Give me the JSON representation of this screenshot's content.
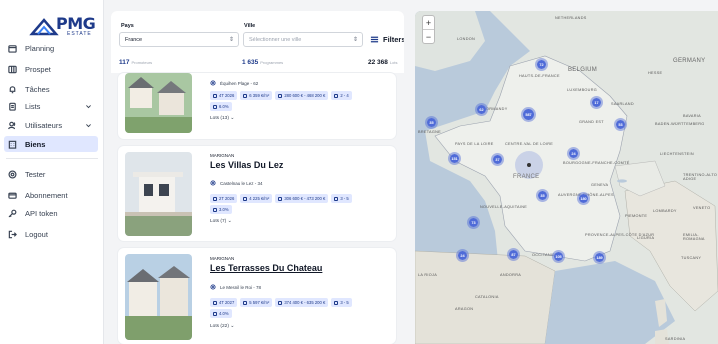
{
  "brand": {
    "name": "PMG",
    "sub": "ESTATE",
    "color": "#1e3a8a"
  },
  "nav": {
    "planning": "Planning",
    "prospect": "Prospet",
    "tasks": "Tâches",
    "lists": "Lists",
    "users": "Utilisateurs",
    "biens": "Biens",
    "tester": "Tester",
    "subscription": "Abonnement",
    "api_token": "API token",
    "logout": "Logout"
  },
  "filters": {
    "country_label": "Pays",
    "country_value": "France",
    "city_label": "Ville",
    "city_placeholder": "Sélectionner une ville",
    "filters_button": "Filters"
  },
  "stats": {
    "promoters_count": "117",
    "promoters_label": "Promoteurs",
    "programs_count": "1 635",
    "programs_label": "Programmes",
    "lots_count": "22 368",
    "lots_label": "Lots"
  },
  "cards": [
    {
      "location": "Équihen Plage - 62",
      "delivery": "4T 2026",
      "price_m2": "6 359 €/m²",
      "price_range": "280 600 € - 468 200 €",
      "rooms": "2 - 4",
      "rate": "6.0%",
      "lots": "Lots (13)"
    },
    {
      "city": "MARIGNAN",
      "title": "Les Villas Du Lez",
      "location": "Castelnau le Lez - 34",
      "delivery": "2T 2026",
      "price_m2": "4 225 €/m²",
      "price_range": "306 600 € - 473 200 €",
      "rooms": "3 - 5",
      "rate": "3.0%",
      "lots": "Lots (7)"
    },
    {
      "city": "MARIGNAN",
      "title": "Les Terrasses Du Chateau",
      "location": "Le Mesnil le Roi - 78",
      "delivery": "4T 2027",
      "price_m2": "5 597 €/m²",
      "price_range": "374 400 € - 635 200 €",
      "rooms": "3 - 5",
      "rate": "4.0%",
      "lots": "Lots (22)"
    }
  ],
  "map": {
    "zoom_in": "+",
    "zoom_out": "−",
    "labels": {
      "london": "LONDON",
      "netherlands": "NETHERLANDS",
      "belgium": "BELGIUM",
      "germany": "GERMANY",
      "hesse": "HESSE",
      "luxembourg": "LUXEMBOURG",
      "saarland": "SAARLAND",
      "bavaria": "BAVARIA",
      "baden": "BADEN-WÜRTTEMBERG",
      "france": "FRANCE",
      "hauts_de_france": "HAUTS-DE-FRANCE",
      "bretagne": "BRETAGNE",
      "pays_de_la_loire": "PAYS DE LA LOIRE",
      "centre": "CENTRE-VAL DE LOIRE",
      "bourgogne": "BOURGOGNE-FRANCHE-COMTÉ",
      "liechtenstein": "LIECHTENSTEIN",
      "trentino": "TRENTINO-ALTO ADIGE",
      "nouvelle_aquitaine": "NOUVELLE-AQUITAINE",
      "auvergne": "AUVERGNE-RHÔNE-ALPES",
      "occitanie": "OCCITANIE",
      "provence": "PROVENCE-ALPES-CÔTE D'AZUR",
      "piemonte": "PIEMONTE",
      "liguria": "LIGURIA",
      "lombardy": "LOMBARDY",
      "veneto": "VENETO",
      "emilia": "EMILIA-ROMAGNA",
      "tuscany": "TUSCANY",
      "la_rioja": "LA RIOJA",
      "catalonia": "CATALONIA",
      "aragon": "ARAGON",
      "andorra": "ANDORRA",
      "sardinia": "SARDINIA",
      "geneva": "GENEVA",
      "grand_est": "GRAND EST",
      "normandy": "NORMANDY"
    },
    "clusters": [
      "72",
      "62",
      "587",
      "17",
      "35",
      "53",
      "151",
      "37",
      "24",
      "35",
      "180",
      "73",
      "24",
      "87",
      "105",
      "189"
    ]
  }
}
